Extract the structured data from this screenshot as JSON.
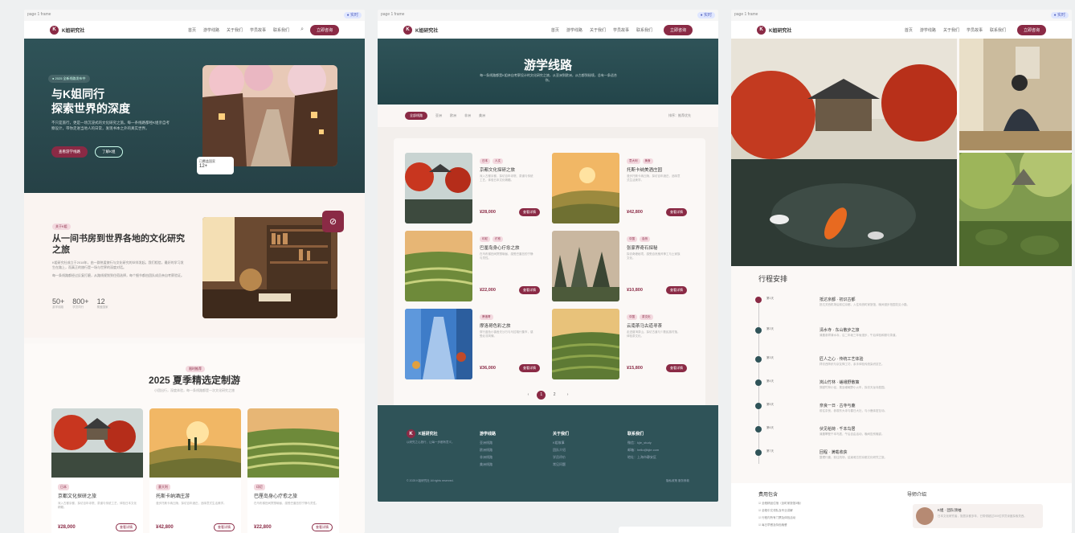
{
  "colors": {
    "accent": "#8a2a45",
    "teal": "#2f5358",
    "background": "#fbf8f6"
  },
  "chrome": {
    "tab": "page 1 frame",
    "badge": "● 实时"
  },
  "nav": {
    "brand": "K姐研究社",
    "items": [
      "首页",
      "游学线路",
      "关于我们",
      "学员故事",
      "联系我们"
    ],
    "cta": "立即咨询"
  },
  "home": {
    "hero": {
      "tag": "● 2025 全新线路发布中",
      "title_line1": "与K姐同行",
      "title_line2": "探索世界的深度",
      "desc": "不只是旅行，更是一场沉浸式的文化研究之旅。每一条线路都经K姐亲自考察设计，带你走进当地人的日常，发现书本之外的真实世界。",
      "btn_primary": "查看游学线路",
      "btn_secondary": "了解K姐",
      "stat_label": "已覆盖国家",
      "stat_value": "12+"
    },
    "story": {
      "badge": "关于K姐",
      "title": "从一间书房到世界各地的文化研究之旅",
      "p1": "K姐研究社成立于2018年，由一群热爱旅行与文化研究的伙伴发起。我们相信，最好的学习发生在路上，而真正的旅行是一场与世界的深度对话。",
      "p2": "每一条线路都经过反复打磨，从路线规划到住宿选择，每个细节都由团队成员亲自考察验证。",
      "stats": [
        {
          "value": "50+",
          "label": "游学线路"
        },
        {
          "value": "800+",
          "label": "学员同行"
        },
        {
          "value": "12",
          "label": "覆盖国家"
        }
      ]
    },
    "summer": {
      "badge": "限时推荐",
      "title": "2025 夏季精选定制游",
      "subtitle": "小团出行，深度体验，每一条线路都是一次文化研究之旅",
      "cards": [
        {
          "tag": "日本",
          "title": "京都文化探研之旅",
          "desc": "深入古都京都，探访百年寺院、茶道与传统工艺，体验日本文化精髓。",
          "price": "¥28,000",
          "btn": "查看详情"
        },
        {
          "tag": "意大利",
          "title": "托斯卡纳酒庄游",
          "desc": "漫步托斯卡纳丘陵，探访百年酒庄，品味意式生活美学。",
          "price": "¥42,800",
          "btn": "查看详情"
        },
        {
          "tag": "印尼",
          "title": "巴厘岛身心疗愈之旅",
          "desc": "在乌布梯田间冥想瑜伽，感受巴厘岛的宁静与灵性。",
          "price": "¥22,800",
          "btn": "查看详情"
        }
      ]
    }
  },
  "routes": {
    "title": "游学线路",
    "subtitle": "每一条线路都是K姐亲自考察设计的文化研究之旅，从亚洲到欧洲，从古都到秘境，总有一条适合你。",
    "filters": [
      "全部线路",
      "亚洲",
      "欧洲",
      "非洲",
      "美洲"
    ],
    "sort_label": "排序：推荐优先",
    "cards": [
      {
        "tags": [
          "日本",
          "人文"
        ],
        "title": "京都文化探研之旅",
        "desc": "深入古都京都，探访百年寺院、茶道与传统工艺，体验日本文化精髓。",
        "price": "¥28,000",
        "btn": "查看详情"
      },
      {
        "tags": [
          "意大利",
          "美食"
        ],
        "title": "托斯卡纳美酒庄园",
        "desc": "漫步托斯卡纳丘陵，探访百年酒庄，品味意式生活美学。",
        "price": "¥42,800",
        "btn": "查看详情"
      },
      {
        "tags": [
          "印尼",
          "疗愈"
        ],
        "title": "巴厘岛身心疗愈之旅",
        "desc": "在乌布梯田间冥想瑜伽，感受巴厘岛的宁静与灵性。",
        "price": "¥22,000",
        "btn": "查看详情"
      },
      {
        "tags": [
          "中国",
          "自然"
        ],
        "title": "张家界奇石探秘",
        "desc": "探访奇峰秘境，感受自然鬼斧神工与土家族文化。",
        "price": "¥10,800",
        "btn": "查看详情"
      },
      {
        "tags": [
          "摩洛哥"
        ],
        "title": "摩洛哥色彩之旅",
        "desc": "穿行蓝色小镇舍夫沙万与马拉喀什集市，感受北非风情。",
        "price": "¥36,000",
        "btn": "查看详情"
      },
      {
        "tags": [
          "中国",
          "茶文化"
        ],
        "title": "云南茶马古道寻茶",
        "desc": "走进普洱茶山，探访古道与少数民族村落，体验茶文化。",
        "price": "¥15,800",
        "btn": "查看详情"
      }
    ],
    "pager": [
      "‹",
      "1",
      "2",
      "›"
    ],
    "footer": {
      "brand": "K姐研究社",
      "tagline": "以研究之心旅行，让每一步都有意义。",
      "cols": [
        {
          "title": "游学线路",
          "items": [
            "亚洲线路",
            "欧洲线路",
            "非洲线路",
            "美洲线路"
          ]
        },
        {
          "title": "关于我们",
          "items": [
            "K姐故事",
            "团队介绍",
            "学员评价",
            "常见问题"
          ]
        },
        {
          "title": "联系我们",
          "items": [
            "微信：kjie_study",
            "邮箱：hello@kjie.com",
            "地址：上海市静安区"
          ]
        }
      ],
      "copy": "© 2025 K姐研究社 All rights reserved.",
      "legal": "隐私政策   服务条款"
    }
  },
  "detail": {
    "itinerary_title": "行程安排",
    "steps": [
      {
        "day": "第1天",
        "title": "抵达京都 · 初识古都",
        "desc": "抵达关西机场后前往京都，入住传统町家旅馆，晚间漫步祇园花见小路。"
      },
      {
        "day": "第2天",
        "title": "清水寺 · 东山散步之旅",
        "desc": "清晨参拜清水寺，沿二年坂三年坂漫步，午后体验和服与茶道。"
      },
      {
        "day": "第3天",
        "title": "匠人之心 · 传统工艺体验",
        "desc": "拜访西阵织与京友禅工坊，亲手体验传统染织技艺。"
      },
      {
        "day": "第4天",
        "title": "岚山竹林 · 嵯峨野散策",
        "desc": "穿越竹林小径，乘坐嵯峨野小火车，探访天龙寺庭园。"
      },
      {
        "day": "第5天",
        "title": "奈良一日 · 古寺与鹿",
        "desc": "前往奈良，参观东大寺与春日大社，与小鹿亲密互动。"
      },
      {
        "day": "第6天",
        "title": "伏见稻荷 · 千本鸟居",
        "desc": "清晨攀登千本鸟居，午后自由活动，晚间告别晚宴。"
      },
      {
        "day": "第7天",
        "title": "回程 · 满载收获",
        "desc": "整理行囊，前往机场，结束难忘的京都文化研究之旅。"
      }
    ],
    "includes_title": "费用包含",
    "includes": [
      "全程精品住宿（含町家旅馆3晚）",
      "全程中文领队及专业讲解",
      "行程内所有门票及体验活动",
      "每日早餐及特色晚餐"
    ],
    "guide_title": "导师介绍",
    "guide_name": "K姐 · 团队领袖",
    "guide_desc": "日本文化研究者，旅居京都多年，已带领超过300位学员深度探索关西。"
  }
}
